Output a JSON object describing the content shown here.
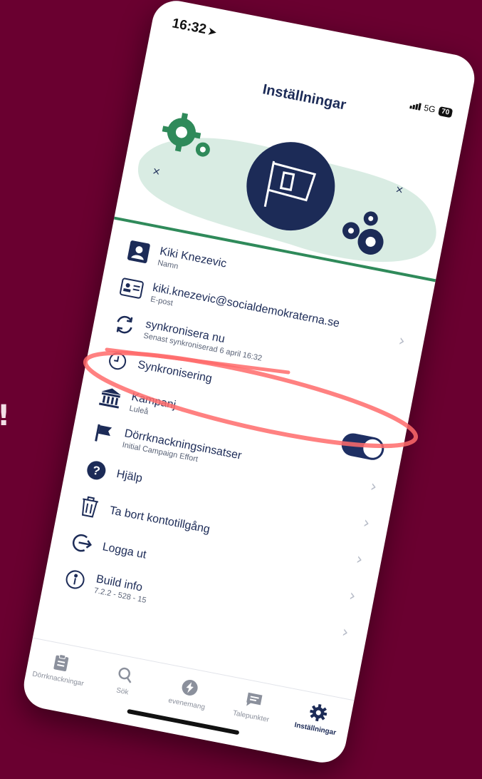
{
  "page": {
    "background_color": "#6a0030",
    "edge_mark": "!"
  },
  "status_bar": {
    "time": "16:32",
    "network": "5G",
    "battery": "70"
  },
  "header": {
    "title": "Inställningar"
  },
  "hero": {
    "icons": [
      "gears-icon",
      "campaign-flag-icon"
    ],
    "colors": {
      "accent_green": "#2f8a5a",
      "navy": "#1c2b57",
      "mint": "#d9ece3"
    }
  },
  "settings": {
    "name": {
      "value": "Kiki Knezevic",
      "label": "Namn"
    },
    "email": {
      "value": "kiki.knezevic@socialdemokraterna.se",
      "label": "E-post"
    },
    "sync_now": {
      "label": "synkronisera nu",
      "sub": "Senast synkroniserad 6 april 16:32"
    },
    "sync": {
      "label": "Synkronisering",
      "enabled": true
    },
    "campaign": {
      "label": "Kampanj",
      "value": "Luleå"
    },
    "door_knocking": {
      "label": "Dörrknackningsinsatser",
      "value": "Initial Campaign Effort"
    },
    "help": {
      "label": "Hjälp"
    },
    "delete_account": {
      "label": "Ta bort kontotillgång"
    },
    "logout": {
      "label": "Logga ut"
    },
    "build": {
      "label": "Build info",
      "value": "7.2.2 - 528 - 15"
    }
  },
  "tabs": [
    {
      "label": "Dörrknackningar",
      "icon": "clipboard-icon"
    },
    {
      "label": "Sök",
      "icon": "search-icon"
    },
    {
      "label": "evenemang",
      "icon": "bolt-icon"
    },
    {
      "label": "Talepunkter",
      "icon": "chat-icon"
    },
    {
      "label": "Inställningar",
      "icon": "gear-icon",
      "active": true
    }
  ],
  "annotation": {
    "color": "#ff6b6b"
  }
}
